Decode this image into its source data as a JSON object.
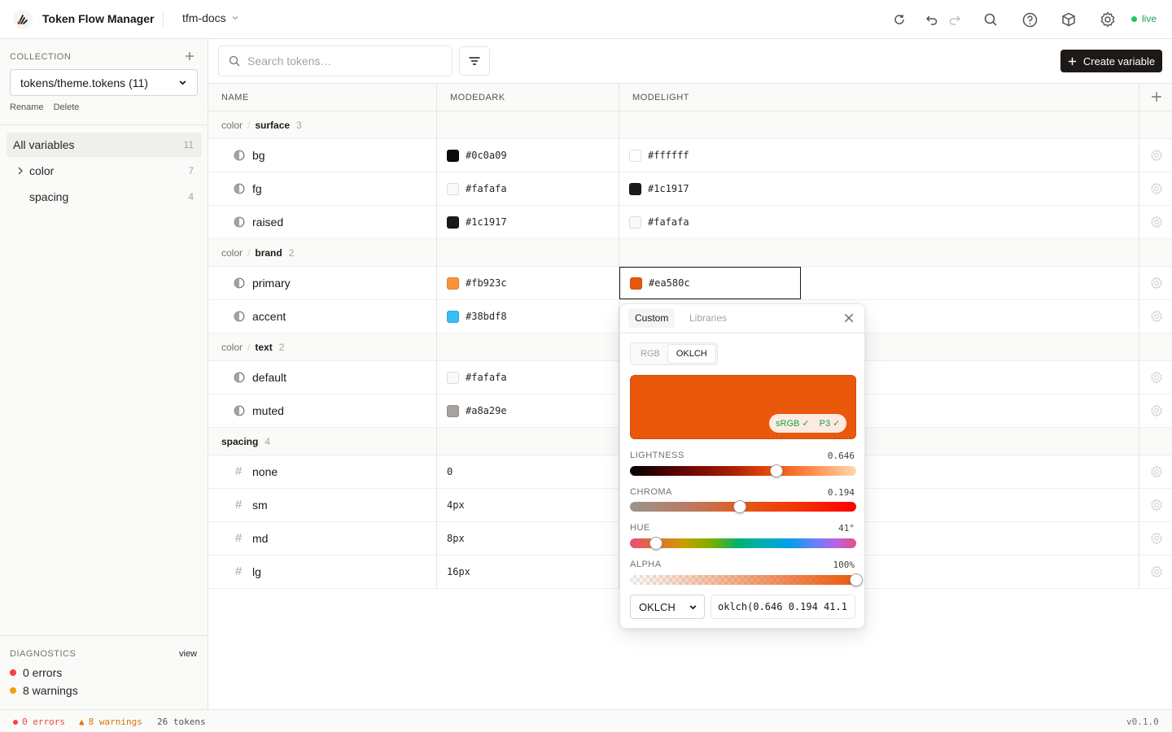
{
  "app": {
    "title": "Token Flow Manager",
    "project": "tfm-docs",
    "status": "live"
  },
  "sidebar": {
    "collection_label": "COLLECTION",
    "collection_value": "tokens/theme.tokens (11)",
    "rename": "Rename",
    "delete": "Delete",
    "nav": [
      {
        "label": "All variables",
        "count": "11"
      },
      {
        "label": "color",
        "count": "7"
      },
      {
        "label": "spacing",
        "count": "4"
      }
    ],
    "diagnostics_label": "DIAGNOSTICS",
    "diagnostics_view": "view",
    "errors": "0 errors",
    "warnings": "8 warnings"
  },
  "toolbar": {
    "search_placeholder": "Search tokens…",
    "create_label": "Create variable"
  },
  "table": {
    "headers": [
      "NAME",
      "MODEDARK",
      "MODELIGHT"
    ],
    "groups": [
      {
        "parent": "color",
        "name": "surface",
        "count": "3"
      },
      {
        "parent": "color",
        "name": "brand",
        "count": "2"
      },
      {
        "parent": "color",
        "name": "text",
        "count": "2"
      },
      {
        "parent": "",
        "name": "spacing",
        "count": "4"
      }
    ],
    "rows": [
      {
        "name": "bg",
        "dark": "#0c0a09",
        "light": "#ffffff"
      },
      {
        "name": "fg",
        "dark": "#fafafa",
        "light": "#1c1917"
      },
      {
        "name": "raised",
        "dark": "#1c1917",
        "light": "#fafafa"
      },
      {
        "name": "primary",
        "dark": "#fb923c",
        "light": "#ea580c"
      },
      {
        "name": "accent",
        "dark": "#38bdf8",
        "light": ""
      },
      {
        "name": "default",
        "dark": "#fafafa",
        "light": ""
      },
      {
        "name": "muted",
        "dark": "#a8a29e",
        "light": ""
      },
      {
        "name": "none",
        "dark": "0",
        "light": ""
      },
      {
        "name": "sm",
        "dark": "4px",
        "light": ""
      },
      {
        "name": "md",
        "dark": "8px",
        "light": ""
      },
      {
        "name": "lg",
        "dark": "16px",
        "light": ""
      }
    ]
  },
  "picker": {
    "tabs": [
      "Custom",
      "Libraries"
    ],
    "modes": [
      "RGB",
      "OKLCH"
    ],
    "color": "#ea580c",
    "gamut_srgb": "sRGB ✓",
    "gamut_p3": "P3 ✓",
    "sliders": [
      {
        "label": "LIGHTNESS",
        "value": "0.646",
        "level": 0.646
      },
      {
        "label": "CHROMA",
        "value": "0.194",
        "level": 0.485
      },
      {
        "label": "HUE",
        "value": "41°",
        "level": 0.114
      },
      {
        "label": "ALPHA",
        "value": "100%",
        "level": 1.0
      }
    ],
    "format": "OKLCH",
    "format_value": "oklch(0.646 0.194 41.1"
  },
  "statusbar": {
    "errors": "0 errors",
    "warnings": "8 warnings",
    "tokens": "26 tokens",
    "version": "v0.1.0"
  }
}
